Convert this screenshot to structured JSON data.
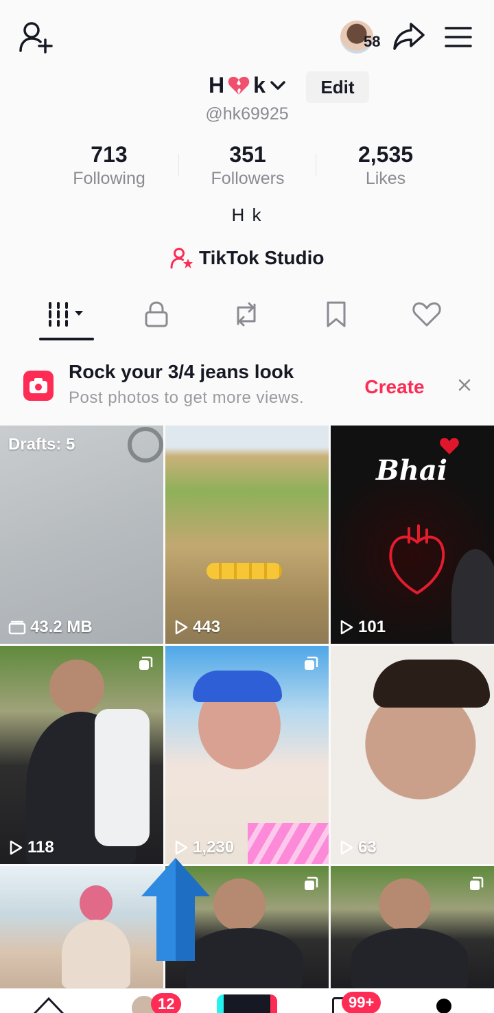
{
  "header": {
    "avatar_count": "58"
  },
  "profile": {
    "name_left": "H",
    "name_right": "k",
    "handle": "@hk69925",
    "edit_label": "Edit",
    "bio": "H k",
    "studio_label": "TikTok Studio"
  },
  "stats": [
    {
      "value": "713",
      "label": "Following"
    },
    {
      "value": "351",
      "label": "Followers"
    },
    {
      "value": "2,535",
      "label": "Likes"
    }
  ],
  "tabs": [
    {
      "icon": "grid-icon",
      "active": true
    },
    {
      "icon": "lock-icon",
      "active": false
    },
    {
      "icon": "repost-icon",
      "active": false
    },
    {
      "icon": "bookmark-icon",
      "active": false
    },
    {
      "icon": "heart-icon",
      "active": false
    }
  ],
  "banner": {
    "title": "Rock your 3/4 jeans look",
    "subtitle": "Post photos to get more views.",
    "create_label": "Create"
  },
  "grid": {
    "drafts_label": "Drafts: 5",
    "items": [
      {
        "count": "43.2 MB",
        "kind": "drafts"
      },
      {
        "count": "443",
        "kind": "video"
      },
      {
        "count": "101",
        "kind": "video",
        "title": "Bhai"
      },
      {
        "count": "118",
        "kind": "photo"
      },
      {
        "count": "1,230",
        "kind": "photo"
      },
      {
        "count": "63",
        "kind": "video"
      },
      {
        "count": "",
        "kind": "video"
      },
      {
        "count": "",
        "kind": "photo"
      },
      {
        "count": "",
        "kind": "photo"
      }
    ]
  },
  "bottom_nav": {
    "friends_badge": "12",
    "inbox_badge": "99+"
  },
  "colors": {
    "accent": "#fe2c55",
    "text": "#161823",
    "muted": "#8a8b91"
  }
}
